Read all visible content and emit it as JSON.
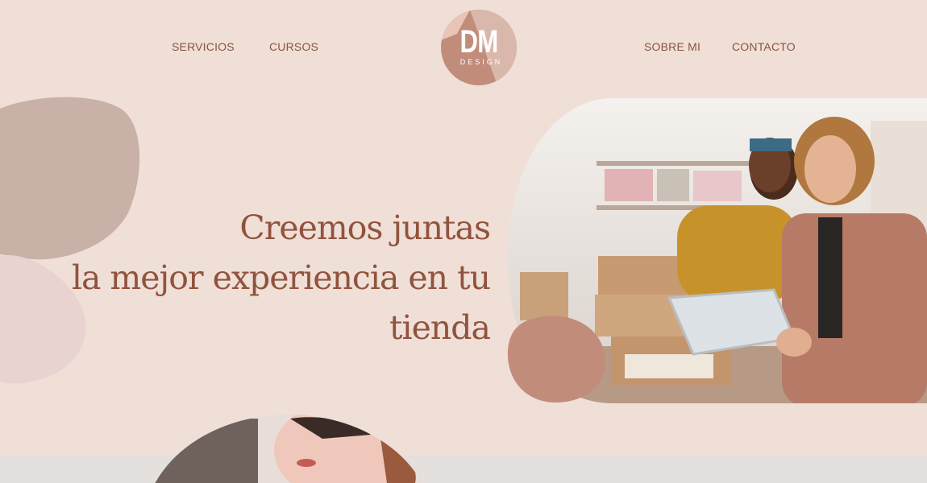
{
  "nav": {
    "servicios": "SERVICIOS",
    "cursos": "CURSOS",
    "sobre_mi": "SOBRE MI",
    "contacto": "CONTACTO"
  },
  "logo": {
    "main": "DM",
    "sub": "DESIGN"
  },
  "hero": {
    "line1": "Creemos juntas",
    "line2": "la mejor experiencia en tu",
    "line3": "tienda"
  },
  "colors": {
    "background": "#efdfd7",
    "accent_text": "#8a5441",
    "blob_taupe": "#c9b1a7",
    "blob_pink": "#e8d3d1",
    "blob_terracotta": "#c28c7b",
    "logo_rose": "#cf9a85",
    "logo_light": "#e3c2b4"
  }
}
